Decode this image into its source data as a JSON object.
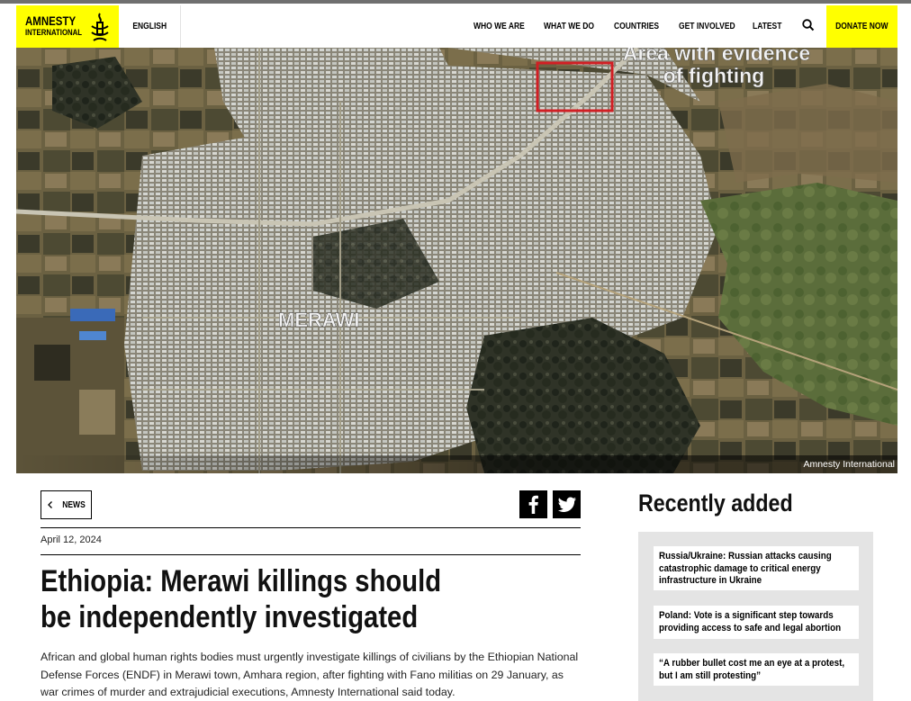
{
  "brand": {
    "logo_line1": "AMNESTY",
    "logo_line2": "INTERNATIONAL",
    "accent_color": "#ffff00"
  },
  "header": {
    "language": "ENGLISH",
    "nav": [
      "WHO WE ARE",
      "WHAT WE DO",
      "COUNTRIES",
      "GET INVOLVED",
      "LATEST"
    ],
    "search_icon": "search-icon",
    "donate_label": "DONATE NOW"
  },
  "hero": {
    "annotation_line1": "Area with evidence",
    "annotation_line2": "of fighting",
    "place_label": "MERAWI",
    "credit": "Amnesty International",
    "highlight_color": "#d11f24"
  },
  "article": {
    "back_label": "NEWS",
    "date": "April 12, 2024",
    "title": "Ethiopia: Merawi killings should be independently investigated",
    "lede": "African and global human rights bodies must urgently investigate killings of civilians by the Ethiopian National Defense Forces (ENDF) in Merawi town, Amhara region, after fighting with Fano militias on 29 January, as war crimes of murder and extrajudicial executions, Amnesty International said today."
  },
  "share": {
    "facebook_icon": "facebook-icon",
    "twitter_icon": "twitter-icon"
  },
  "recent": {
    "heading": "Recently added",
    "items": [
      "Russia/Ukraine: Russian attacks causing catastrophic damage to critical energy infrastructure in Ukraine",
      "Poland: Vote is a significant step towards providing access to safe and legal abortion",
      "“A rubber bullet cost me an eye at a protest, but I am still protesting”"
    ]
  }
}
